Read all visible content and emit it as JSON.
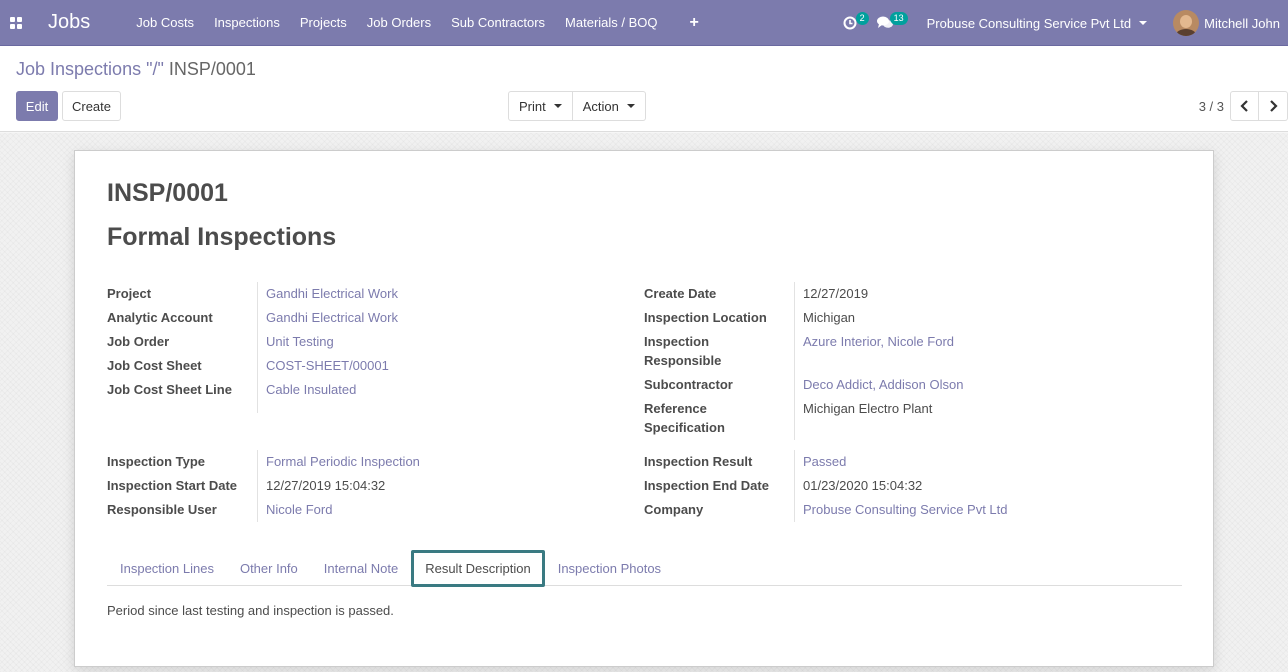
{
  "navbar": {
    "brand": "Jobs",
    "menu": [
      "Job Costs",
      "Inspections",
      "Projects",
      "Job Orders",
      "Sub Contractors",
      "Materials / BOQ"
    ],
    "plus": "+",
    "activity_count": "2",
    "messages_count": "13",
    "company": "Probuse Consulting Service Pvt Ltd",
    "user": "Mitchell John"
  },
  "control": {
    "breadcrumb_parent": "Job Inspections \"/\"",
    "breadcrumb_current": "INSP/0001",
    "edit_label": "Edit",
    "create_label": "Create",
    "print_label": "Print",
    "action_label": "Action",
    "pager_value": "3 / 3"
  },
  "form": {
    "code": "INSP/0001",
    "name": "Formal Inspections",
    "left_group1": [
      {
        "label": "Project",
        "value": "Gandhi Electrical Work"
      },
      {
        "label": "Analytic Account",
        "value": "Gandhi Electrical Work"
      },
      {
        "label": "Job Order",
        "value": "Unit Testing"
      },
      {
        "label": "Job Cost Sheet",
        "value": "COST-SHEET/00001"
      },
      {
        "label": "Job Cost Sheet Line",
        "value": "Cable Insulated"
      }
    ],
    "right_group1": [
      {
        "label": "Create Date",
        "value": "12/27/2019"
      },
      {
        "label": "Inspection Location",
        "value": "Michigan"
      },
      {
        "label": "Inspection Responsible",
        "value": "Azure Interior, Nicole Ford"
      },
      {
        "label": "Subcontractor",
        "value": "Deco Addict, Addison Olson"
      },
      {
        "label": "Reference Specification",
        "value": "Michigan Electro Plant"
      }
    ],
    "left_group2": [
      {
        "label": "Inspection Type",
        "value": "Formal Periodic Inspection"
      },
      {
        "label": "Inspection Start Date",
        "value": "12/27/2019 15:04:32"
      },
      {
        "label": "Responsible User",
        "value": "Nicole Ford"
      }
    ],
    "right_group2": [
      {
        "label": "Inspection Result",
        "value": "Passed"
      },
      {
        "label": "Inspection End Date",
        "value": "01/23/2020 15:04:32"
      },
      {
        "label": "Company",
        "value": "Probuse Consulting Service Pvt Ltd"
      }
    ],
    "tabs": [
      "Inspection Lines",
      "Other Info",
      "Internal Note",
      "Result Description",
      "Inspection Photos"
    ],
    "active_tab": "Result Description",
    "result_description": "Period since last testing and inspection is passed."
  },
  "colors": {
    "brand": "#7c7bad",
    "badge": "#00a09d",
    "active_tab_border": "#3a7a82"
  }
}
